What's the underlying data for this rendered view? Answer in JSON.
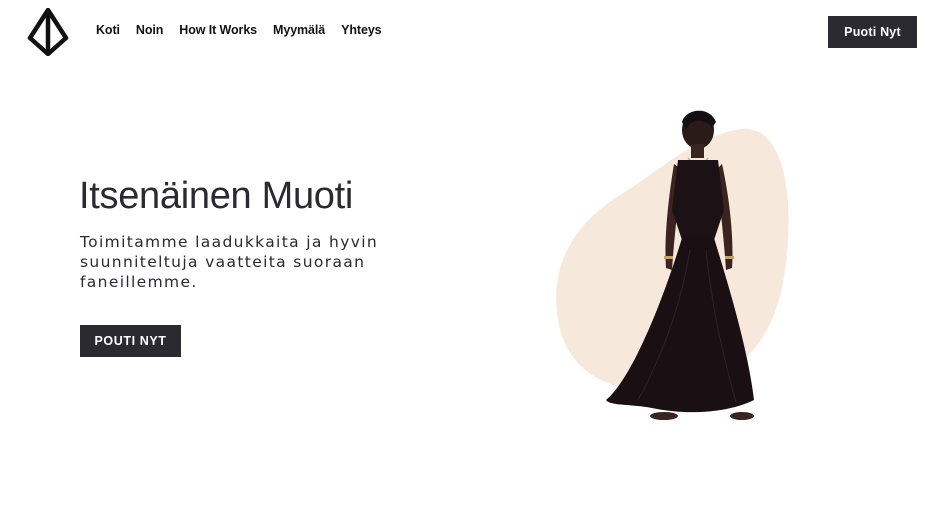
{
  "header": {
    "logo_icon": "pyramid-logo-icon",
    "nav": [
      {
        "label": "Koti"
      },
      {
        "label": "Noin"
      },
      {
        "label": "How It Works"
      },
      {
        "label": "Myymälä"
      },
      {
        "label": "Yhteys"
      }
    ],
    "cta_label": "Puoti Nyt"
  },
  "hero": {
    "title": "Itsenäinen Muoti",
    "subtitle": "Toimitamme laadukkaita ja hyvin suunniteltuja vaatteita suoraan faneillemme.",
    "cta_label": "POUTI NYT",
    "image_icon": "model-in-black-dress-illustration"
  },
  "colors": {
    "primary": "#2b2a30",
    "blob": "#f7e8dc",
    "background": "#ffffff"
  }
}
